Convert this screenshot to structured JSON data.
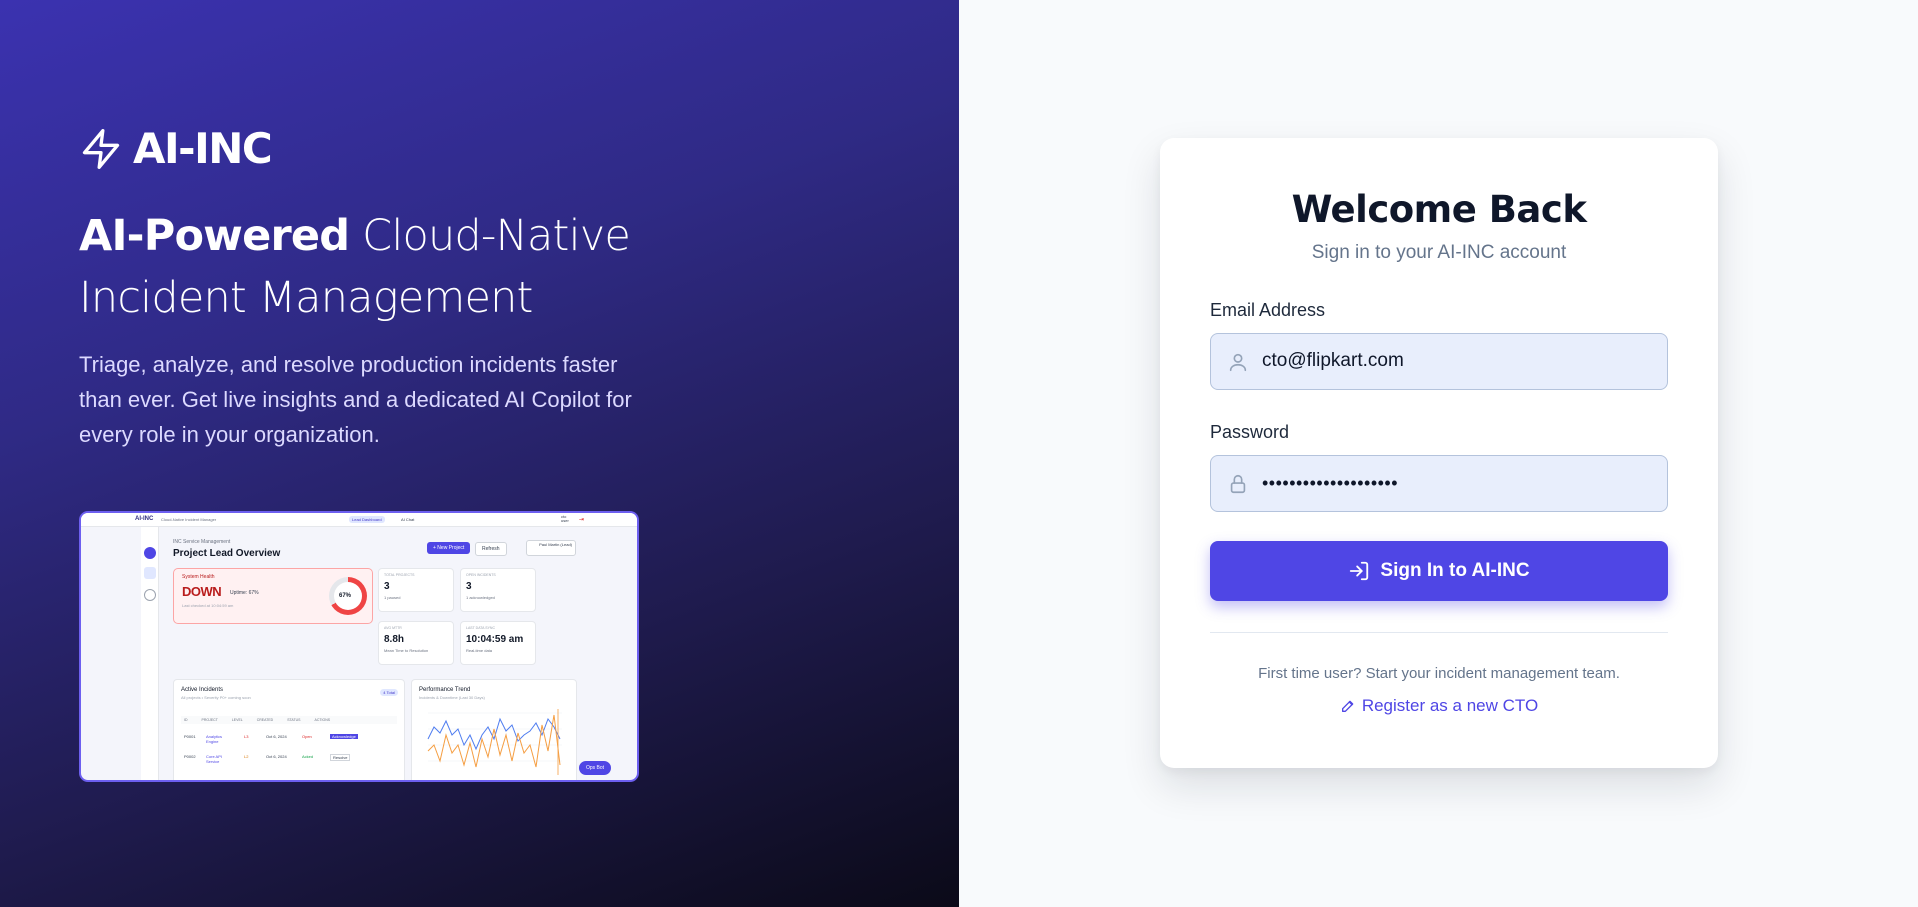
{
  "brand": {
    "name": "AI-INC"
  },
  "hero": {
    "headline_bold": "AI-Powered",
    "headline_rest": " Cloud-Native Incident Management",
    "tagline": "Triage, analyze, and resolve production incidents faster than ever. Get live insights and a dedicated AI Copilot for every role in your organization."
  },
  "preview": {
    "logo": "AI-INC",
    "logo_sub": "Cloud-Native Incident Manager",
    "top_pill": "Lead Dashboard",
    "top_copilot": "AI Chat",
    "user": "cto user",
    "section": "INC Service Management",
    "title": "Project Lead Overview",
    "new_project": "+ New Project",
    "refresh": "Refresh",
    "selector": "Paul Martin (Lead)",
    "health_label": "System Health",
    "health_status": "DOWN",
    "health_uptime": "Uptime: 67%",
    "health_note": "Last checked at 10:04:59 am",
    "health_ring": "67%",
    "cards": [
      {
        "key": "Total Projects",
        "value": "3",
        "sub": "1 paused"
      },
      {
        "key": "Open Incidents",
        "value": "3",
        "sub": "1 acknowledged"
      },
      {
        "key": "Avg MTTR",
        "value": "8.8h",
        "sub": "Mean Time to Resolution"
      },
      {
        "key": "Last Data Sync",
        "value": "10:04:59 am",
        "sub": "Real-time data"
      }
    ],
    "incidents_title": "Active Incidents",
    "incidents_sub": "All projects • Severity P0+ coming soon",
    "incidents_total": "4 Total",
    "columns": [
      "ID",
      "PROJECT",
      "LEVEL",
      "CREATED",
      "STATUS",
      "ACTIONS"
    ],
    "rows": [
      {
        "id": "P0001",
        "project": "Analytics Engine",
        "level": "L3",
        "created": "Oct 6, 2024",
        "status": "Open",
        "action": "Acknowledge"
      },
      {
        "id": "P0002",
        "project": "Core API Service",
        "level": "L2",
        "created": "Oct 6, 2024",
        "status": "Acked",
        "action": "Resolve"
      }
    ],
    "perf_title": "Performance Trend",
    "perf_sub": "Incidents & Downtime (Last 30 Days)",
    "bot": "Ops Bot"
  },
  "login": {
    "title": "Welcome Back",
    "subtitle": "Sign in to your AI-INC account",
    "email_label": "Email Address",
    "email_value": "cto@flipkart.com",
    "password_label": "Password",
    "password_value": "••••••••••••••••••••",
    "submit_label": "Sign In to AI-INC",
    "first_time": "First time user? Start your incident management team.",
    "register_label": "Register as a new CTO"
  },
  "colors": {
    "accent": "#4f46e5",
    "hero_start": "#3b32b0",
    "hero_end": "#0b0a18",
    "field_bg": "#e8eefc"
  },
  "icons": {
    "brand": "lightning-bolt-icon",
    "email": "user-icon",
    "password": "lock-icon",
    "submit": "log-in-icon",
    "register": "pencil-icon"
  }
}
